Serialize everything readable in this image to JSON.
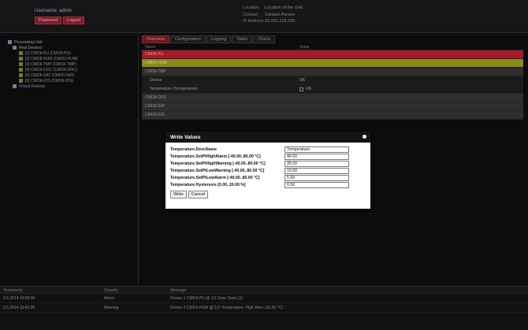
{
  "header": {
    "user_label": "Username: admin",
    "buttons": [
      "Password",
      "Logout"
    ],
    "info": [
      {
        "label": "Location",
        "value": "Location of the Unit"
      },
      {
        "label": "Contact",
        "value": "Contact Person"
      },
      {
        "label": "IP Address",
        "value": "10.201.216.230"
      }
    ]
  },
  "tree": {
    "items": [
      {
        "label": "Processing Unit",
        "level": 0,
        "icon": "folder-icon"
      },
      {
        "label": "Real Devices",
        "level": 1,
        "icon": "folder-icon"
      },
      {
        "label": "[1] CMOII-PU (CMOII-PU)",
        "level": 2,
        "icon": "device-icon"
      },
      {
        "label": "[2] CMOII-HUM (CMOII-HUM)",
        "level": 2,
        "icon": "device-icon"
      },
      {
        "label": "[3] CMOII-TMP (CMOII-TMP)",
        "level": 2,
        "icon": "device-icon"
      },
      {
        "label": "[4] CMOII-DOC (CMOII-DOC)",
        "level": 2,
        "icon": "device-icon"
      },
      {
        "label": "[5] CMOII-SAT (CMOII-SAT)",
        "level": 2,
        "icon": "device-icon"
      },
      {
        "label": "[6] CMOII-IOS (CMOII-IOS)",
        "level": 2,
        "icon": "device-icon"
      },
      {
        "label": "Virtual Devices",
        "level": 1,
        "icon": "folder-icon"
      }
    ]
  },
  "main": {
    "tabs": [
      "Overview",
      "Configuration",
      "Logging",
      "Tasks",
      "Charts"
    ],
    "active_tab": 0,
    "columns": {
      "name": "Name",
      "value": "Value"
    },
    "rows": [
      {
        "name": "CMOII-PU",
        "value": "",
        "style": "red"
      },
      {
        "name": "CMOII-HUM",
        "value": "",
        "style": "yel"
      },
      {
        "name": "CMOII-TMP",
        "value": "",
        "style": "gray"
      },
      {
        "name": "Device",
        "value": "OK",
        "style": "sub"
      },
      {
        "name": "Temperature (Temperature)",
        "value": "OK",
        "style": "sub check"
      },
      {
        "name": "CMOII-DOC",
        "value": "",
        "style": "gray"
      },
      {
        "name": "CMOII-SAT",
        "value": "",
        "style": "gray"
      },
      {
        "name": "CMOII-IOS",
        "value": "",
        "style": "gray"
      }
    ]
  },
  "dialog": {
    "title": "Write Values",
    "fields": [
      {
        "label": "Temperature.DescName",
        "value": "Temperature"
      },
      {
        "label": "Temperature.SetPtHighAlarm [-40.00..80.00 °C]",
        "value": "40.00"
      },
      {
        "label": "Temperature.SetPtHighWarning [-40.00..80.00 °C]",
        "value": "35.00"
      },
      {
        "label": "Temperature.SetPtLowWarning [-40.00..80.00 °C]",
        "value": "10.00"
      },
      {
        "label": "Temperature.SetPtLowAlarm [-40.00..80.00 °C]",
        "value": "5.00"
      },
      {
        "label": "Temperature.Hysteresis [0.00..20.00 %]",
        "value": "0.50"
      }
    ],
    "write_label": "Write",
    "cancel_label": "Cancel"
  },
  "log": {
    "columns": {
      "timestamp": "Timestamp",
      "severity": "Severity",
      "message": "Message"
    },
    "rows": [
      {
        "timestamp": "3.5.2014 10:05:00",
        "severity": "Alarm",
        "message": "Device 1 CMOII-PU @ 1/1 Door Open (1)"
      },
      {
        "timestamp": "3.5.2014 10:42:35",
        "severity": "Warning",
        "message": "Device 2 CMOII-HUM @ 1/2 Temperature: High Warn (35.50 °C)"
      }
    ]
  }
}
